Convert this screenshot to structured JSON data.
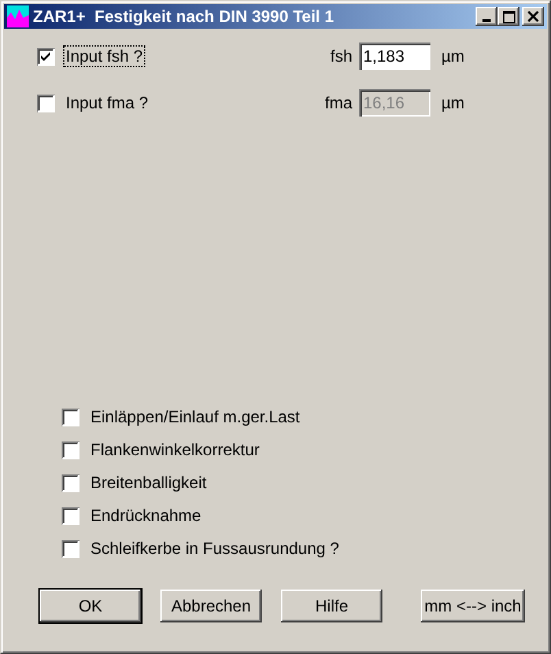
{
  "window": {
    "title": "ZAR1+  Festigkeit nach DIN 3990 Teil 1"
  },
  "inputs": [
    {
      "label": "Input fsh ?",
      "checked": true,
      "focused": true,
      "field_label": "fsh",
      "value": "1,183",
      "disabled": false,
      "unit": "µm"
    },
    {
      "label": "Input fma ?",
      "checked": false,
      "focused": false,
      "field_label": "fma",
      "value": "16,16",
      "disabled": true,
      "unit": "µm"
    }
  ],
  "options": [
    {
      "label": "Einläppen/Einlauf m.ger.Last",
      "checked": false
    },
    {
      "label": "Flankenwinkelkorrektur",
      "checked": false
    },
    {
      "label": "Breitenballigkeit",
      "checked": false
    },
    {
      "label": "Endrücknahme",
      "checked": false
    },
    {
      "label": "Schleifkerbe in Fussausrundung ?",
      "checked": false
    }
  ],
  "buttons": [
    {
      "label": "OK",
      "default": true
    },
    {
      "label": "Abbrechen",
      "default": false
    },
    {
      "label": "Hilfe",
      "default": false
    },
    {
      "label": "mm <--> inch",
      "default": false
    }
  ]
}
